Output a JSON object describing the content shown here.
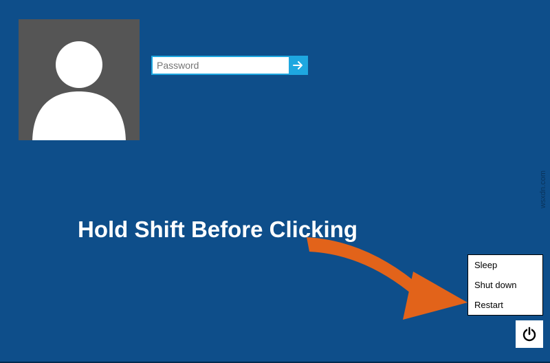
{
  "colors": {
    "background": "#0e4e8a",
    "accent": "#1ea7e0",
    "arrow": "#e2631a",
    "avatar_bg": "#555555"
  },
  "login": {
    "password_placeholder": "Password"
  },
  "instruction_text": "Hold Shift Before Clicking",
  "power_menu": {
    "items": [
      {
        "label": "Sleep"
      },
      {
        "label": "Shut down"
      },
      {
        "label": "Restart"
      }
    ]
  },
  "icons": {
    "avatar": "person-icon",
    "submit": "arrow-right-icon",
    "power": "power-icon",
    "pointer": "arrow-pointer-icon"
  },
  "watermark": "wsxdn.com"
}
